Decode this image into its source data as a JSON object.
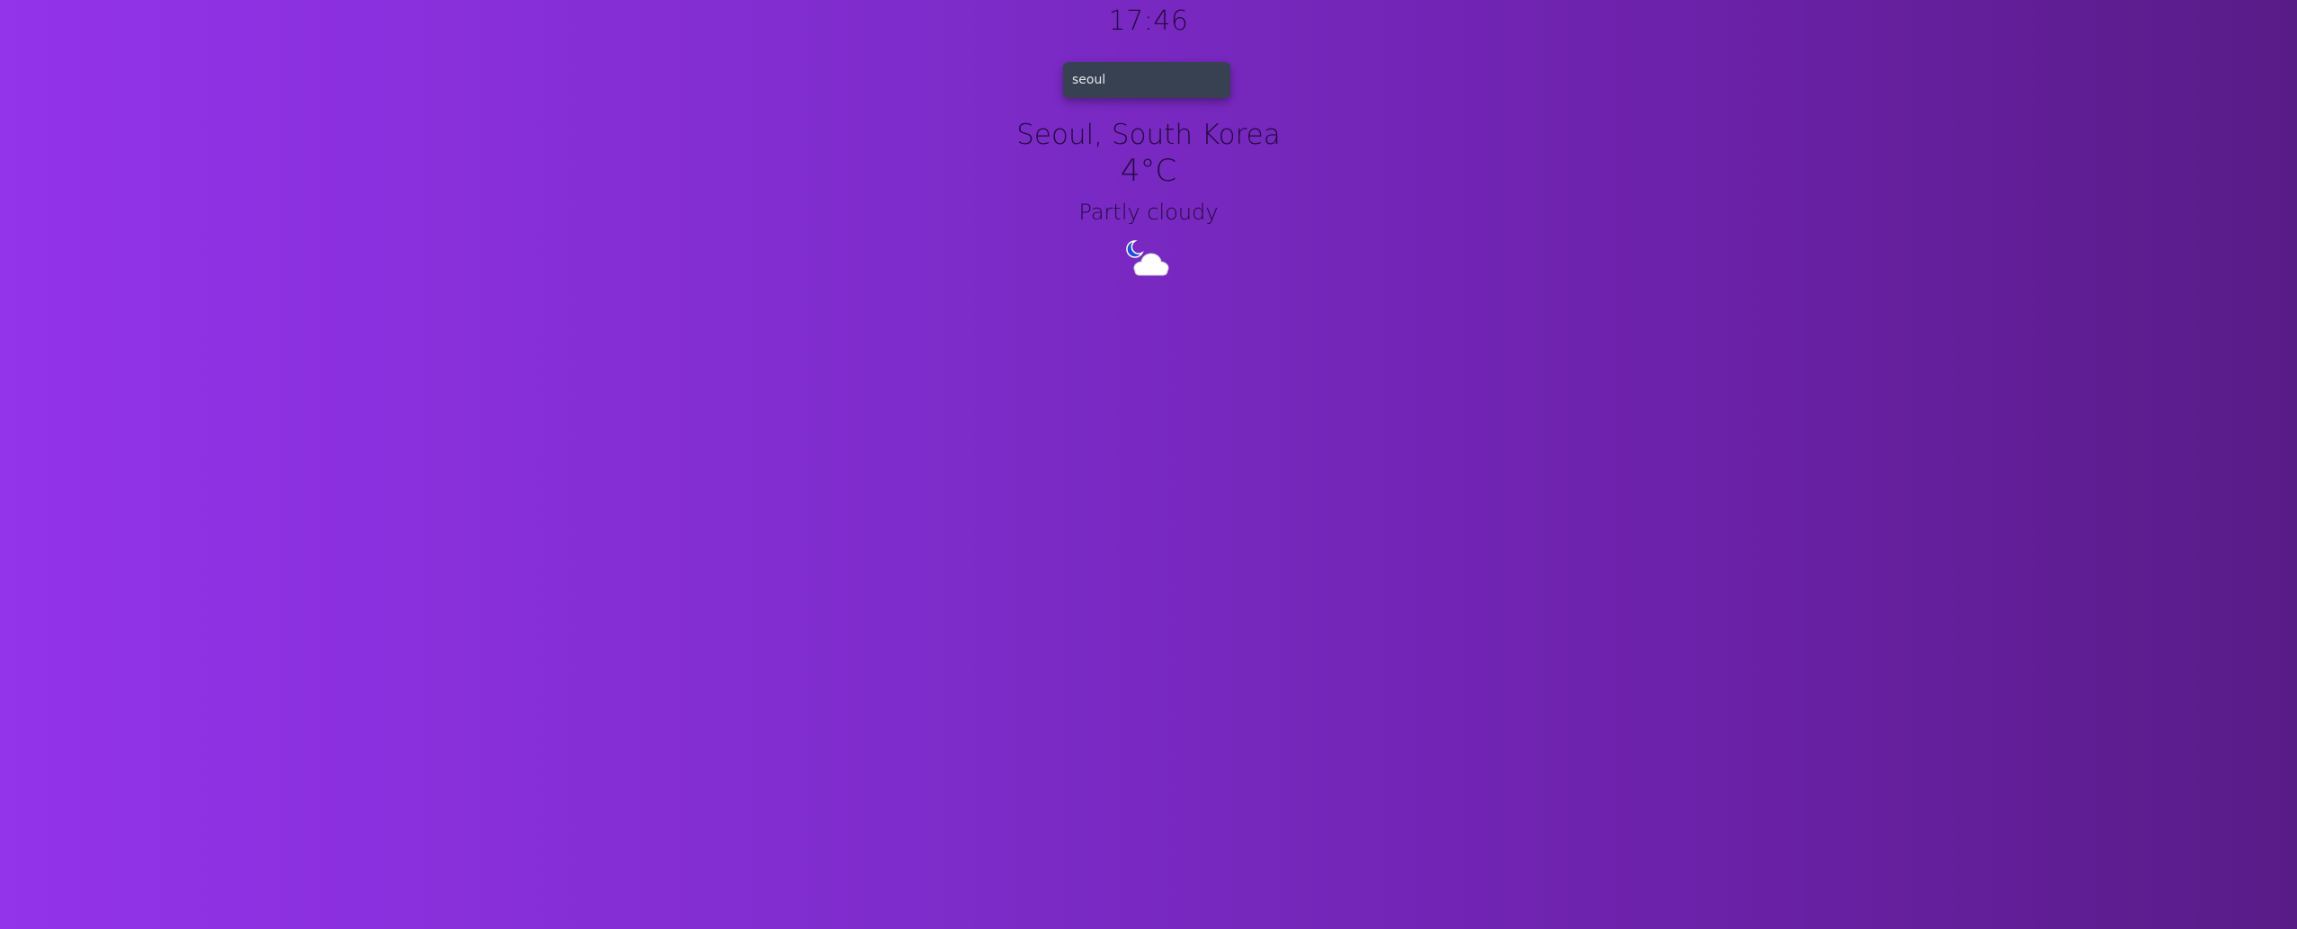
{
  "clock": {
    "time": "17:46"
  },
  "search": {
    "value": "seoul",
    "placeholder": ""
  },
  "weather": {
    "location": "Seoul, South Korea",
    "temperature": "4°C",
    "condition": "Partly cloudy",
    "icon": "moon-cloud-icon"
  },
  "colors": {
    "background_start": "#9333ea",
    "background_end": "#581c87",
    "input_background": "#374151",
    "text": "#22093f"
  }
}
